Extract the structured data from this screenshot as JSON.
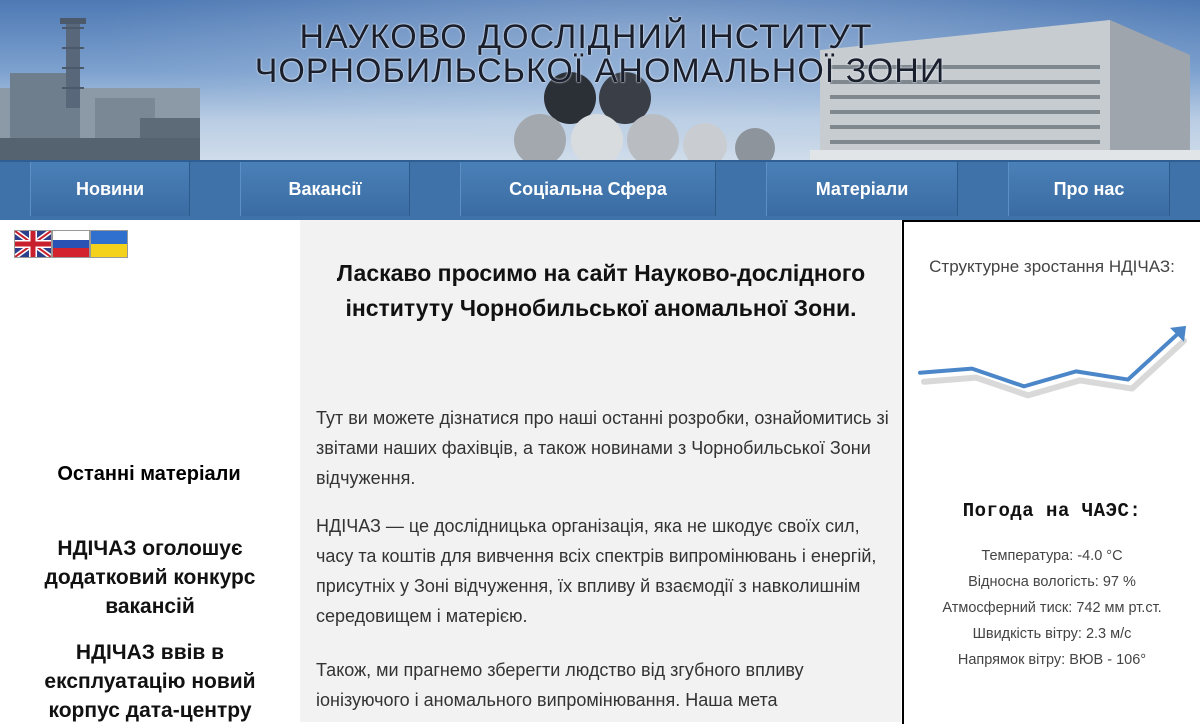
{
  "banner": {
    "title_line1": "НАУКОВО ДОСЛІДНИЙ ІНСТИТУТ",
    "title_line2": "ЧОРНОБИЛЬСЬКОЇ АНОМАЛЬНОЇ ЗОНИ"
  },
  "nav": {
    "items": [
      {
        "label": "Новини"
      },
      {
        "label": "Вакансії"
      },
      {
        "label": "Соціальна Сфера"
      },
      {
        "label": "Матеріали"
      },
      {
        "label": "Про нас"
      }
    ]
  },
  "languages": [
    {
      "name": "english-flag"
    },
    {
      "name": "russian-flag"
    },
    {
      "name": "ukrainian-flag"
    }
  ],
  "sidebar": {
    "latest_title": "Останні матеріали",
    "items": [
      {
        "title": "НДІЧАЗ оголошує додатковий конкурс вакансій"
      },
      {
        "title": "НДІЧАЗ ввів в експлуатацію новий корпус дата-центру"
      }
    ]
  },
  "main": {
    "welcome": "Ласкаво просимо на сайт Науково-дослідного інституту Чорнобильської аномальної Зони.",
    "paragraphs": [
      "Тут ви можете дізнатися про наші останні розробки, ознайомитись зі звітами наших фахівців, а також новинами з Чорнобильської Зони відчуження.",
      "НДІЧАЗ — це дослідницька організація, яка не шкодує своїх сил, часу та коштів для вивчення всіх спектрів випромінювань і енергій, присутніх у Зоні відчуження, їх впливу й взаємодії з навколишнім середовищем і матерією.",
      "Також, ми прагнемо зберегти людство від згубного впливу іонізуючого і аномального випромінювання. Наша мета"
    ]
  },
  "growth": {
    "title": "Структурне зростання НДІЧАЗ:",
    "trend_values": [
      2.0,
      2.3,
      1.0,
      2.1,
      1.5,
      5.0
    ],
    "line_color": "#4a86c8",
    "shadow_color": "#d9d9d9"
  },
  "weather": {
    "title": "Погода на ЧАЭС:",
    "rows": [
      {
        "text": "Температура: -4.0 °C"
      },
      {
        "text": "Відносна вологість: 97 %"
      },
      {
        "text": "Атмосферний тиск: 742 мм рт.ст."
      },
      {
        "text": "Швидкість вітру: 2.3 м/с"
      },
      {
        "text": "Напрямок вітру: ВЮВ - 106°"
      }
    ]
  },
  "colors": {
    "nav_bg": "#3f72a8",
    "center_bg": "#f2f2f2",
    "accent_blue": "#4a86c8"
  }
}
